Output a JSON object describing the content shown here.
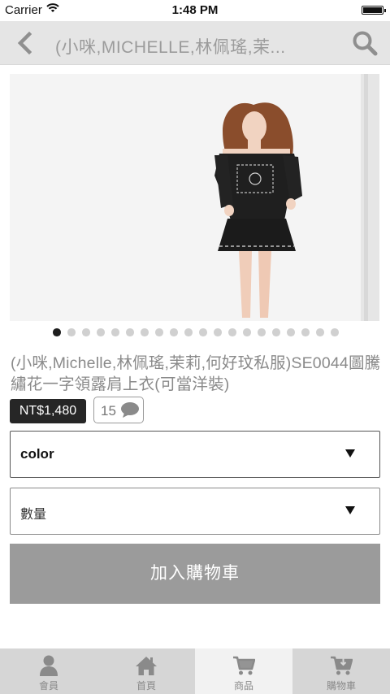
{
  "status_bar": {
    "carrier": "Carrier",
    "time": "1:48 PM"
  },
  "nav": {
    "title": "(小咪,MICHELLE,林佩瑤,茉...",
    "back_icon": "chevron-left-icon",
    "search_icon": "search-icon"
  },
  "product": {
    "image_description_icon": "product-photo",
    "pager": {
      "count": 20,
      "active_index": 0
    },
    "title": "(小咪,Michelle,林佩瑤,茉莉,何好玟私服)SE0044圖騰繡花一字領露肩上衣(可當洋裝)",
    "price": "NT$1,480",
    "comment_count": "15"
  },
  "options": {
    "color_label": "color",
    "quantity_label": "數量"
  },
  "actions": {
    "add_to_cart": "加入購物車"
  },
  "tabs": [
    {
      "label": "會員",
      "icon": "user-icon",
      "active": false
    },
    {
      "label": "首頁",
      "icon": "home-icon",
      "active": false
    },
    {
      "label": "商品",
      "icon": "cart-icon",
      "active": true
    },
    {
      "label": "購物車",
      "icon": "cart-download-icon",
      "active": false
    }
  ],
  "colors": {
    "nav_bg": "#e5e5e5",
    "price_bg": "#262626",
    "button_bg": "#9b9b9b",
    "tab_bg": "#d6d6d6",
    "tab_active_bg": "#f2f2f2"
  }
}
